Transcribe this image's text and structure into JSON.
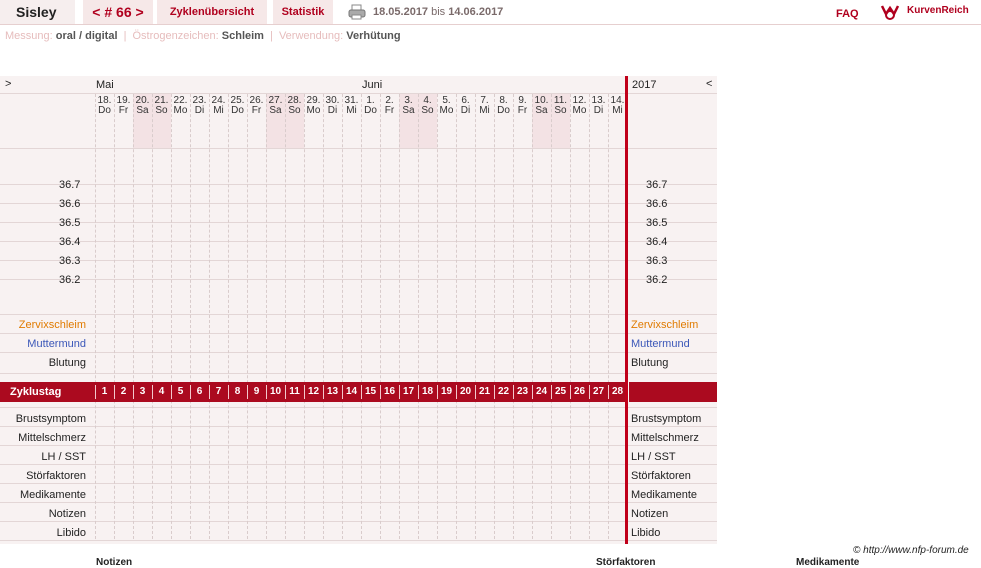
{
  "header": {
    "user": "Sisley",
    "cycle_nav": "< # 66 >",
    "tab_overview": "Zyklenübersicht",
    "tab_stats": "Statistik",
    "date_from": "18.05.2017",
    "date_to_word": "bis",
    "date_to": "14.06.2017",
    "faq": "FAQ",
    "brand": "KurvenReich"
  },
  "settings": {
    "measure_label": "Messung:",
    "measure_value": "oral / digital",
    "estrogen_label": "Östrogenzeichen:",
    "estrogen_value": "Schleim",
    "use_label": "Verwendung:",
    "use_value": "Verhütung"
  },
  "chart": {
    "nav_left": ">",
    "nav_right": "<",
    "month1": "Mai",
    "month2": "Juni",
    "year": "2017",
    "days": [
      {
        "d": "18.",
        "w": "Do",
        "we": false
      },
      {
        "d": "19.",
        "w": "Fr",
        "we": false
      },
      {
        "d": "20.",
        "w": "Sa",
        "we": true
      },
      {
        "d": "21.",
        "w": "So",
        "we": true
      },
      {
        "d": "22.",
        "w": "Mo",
        "we": false
      },
      {
        "d": "23.",
        "w": "Di",
        "we": false
      },
      {
        "d": "24.",
        "w": "Mi",
        "we": false
      },
      {
        "d": "25.",
        "w": "Do",
        "we": false
      },
      {
        "d": "26.",
        "w": "Fr",
        "we": false
      },
      {
        "d": "27.",
        "w": "Sa",
        "we": true
      },
      {
        "d": "28.",
        "w": "So",
        "we": true
      },
      {
        "d": "29.",
        "w": "Mo",
        "we": false
      },
      {
        "d": "30.",
        "w": "Di",
        "we": false
      },
      {
        "d": "31.",
        "w": "Mi",
        "we": false
      },
      {
        "d": "1.",
        "w": "Do",
        "we": false
      },
      {
        "d": "2.",
        "w": "Fr",
        "we": false
      },
      {
        "d": "3.",
        "w": "Sa",
        "we": true
      },
      {
        "d": "4.",
        "w": "So",
        "we": true
      },
      {
        "d": "5.",
        "w": "Mo",
        "we": false
      },
      {
        "d": "6.",
        "w": "Di",
        "we": false
      },
      {
        "d": "7.",
        "w": "Mi",
        "we": false
      },
      {
        "d": "8.",
        "w": "Do",
        "we": false
      },
      {
        "d": "9.",
        "w": "Fr",
        "we": false
      },
      {
        "d": "10.",
        "w": "Sa",
        "we": true
      },
      {
        "d": "11.",
        "w": "So",
        "we": true
      },
      {
        "d": "12.",
        "w": "Mo",
        "we": false
      },
      {
        "d": "13.",
        "w": "Di",
        "we": false
      },
      {
        "d": "14.",
        "w": "Mi",
        "we": false
      }
    ],
    "temps": [
      "36.7",
      "36.6",
      "36.5",
      "36.4",
      "36.3",
      "36.2"
    ],
    "rows_mid": [
      {
        "label": "Zervixschleim",
        "color": "#e07b00"
      },
      {
        "label": "Muttermund",
        "color": "#3b57b8"
      },
      {
        "label": "Blutung",
        "color": "#222222"
      }
    ],
    "cycle_label": "Zyklustag",
    "cycle_days": [
      "1",
      "2",
      "3",
      "4",
      "5",
      "6",
      "7",
      "8",
      "9",
      "10",
      "11",
      "12",
      "13",
      "14",
      "15",
      "16",
      "17",
      "18",
      "19",
      "20",
      "21",
      "22",
      "23",
      "24",
      "25",
      "26",
      "27",
      "28"
    ],
    "rows_bottom": [
      "Brustsymptom",
      "Mittelschmerz",
      "LH / SST",
      "Störfaktoren",
      "Medikamente",
      "Notizen",
      "Libido"
    ]
  },
  "footer": {
    "copyright": "© http://www.nfp-forum.de",
    "bottom_labels": [
      "Notizen",
      "Störfaktoren",
      "Medikamente"
    ]
  }
}
